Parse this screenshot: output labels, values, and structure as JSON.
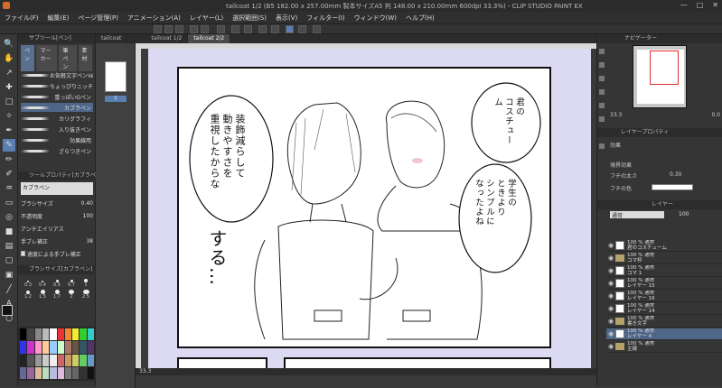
{
  "window": {
    "title": "tailcoat 1/2 (B5 182.00 x 257.00mm 製本サイズA5 判 148.00 x 210.00mm 600dpi 33.3%) - CLIP STUDIO PAINT EX",
    "controls": [
      "—",
      "□",
      "✕"
    ]
  },
  "menu": [
    "ファイル(F)",
    "編集(E)",
    "ページ管理(P)",
    "アニメーション(A)",
    "レイヤー(L)",
    "選択範囲(S)",
    "表示(V)",
    "フィルター(I)",
    "ウィンドウ(W)",
    "ヘルプ(H)"
  ],
  "subtool": {
    "header": "サブツール[ペン]",
    "tabs": [
      "ペン",
      "マーカー",
      "筆ペン",
      "素材"
    ],
    "brushes": [
      "お気軽文字ペンVer2.0",
      "ちょっぴりニッチな線文字ペン",
      "重っぽいGペン",
      "カブラペン",
      "カリグラフィ",
      "入り抜きペン",
      "効果線用",
      "ざらつきペン"
    ],
    "active_brush_index": 3
  },
  "tool_property": {
    "header": "ツールプロパティ[カブラペン]",
    "name": "カブラペン",
    "rows": [
      {
        "label": "ブラシサイズ",
        "value": "0.40"
      },
      {
        "label": "不透明度",
        "value": "100"
      },
      {
        "label": "アンチエイリアス",
        "value": ""
      },
      {
        "label": "手ブレ補正",
        "value": "38"
      },
      {
        "label": "速度による手ブレ補正",
        "value": ""
      }
    ]
  },
  "brush_size": {
    "header": "ブラシサイズ[カブラペン]",
    "sizes": [
      "0.3",
      "0.4",
      "0.5",
      "0.7",
      "1",
      "1.2",
      "1.5",
      "1.7",
      "2",
      "2.5"
    ]
  },
  "document_tabs": [
    "tailcoat",
    "tailcoat 1/2",
    "tailcoat 2/2"
  ],
  "page_strip": {
    "page_number": "1"
  },
  "status": {
    "zoom": "33.3"
  },
  "manga": {
    "bubble_left": "装飾減らして\n動きやすさを\n重視したからな",
    "bubble_right_top": "君の\nコスチューム",
    "bubble_right_bottom": "学生の\nときより\nシンプルに\nなったよね",
    "sfx": "する…"
  },
  "navigator": {
    "header": "ナビゲーター",
    "zoom": "33.3",
    "angle": "0.0"
  },
  "layer_property": {
    "header": "レイヤープロパティ",
    "effect_label": "効果",
    "border_label": "境界効果",
    "edge_width_label": "フチの太さ",
    "edge_width_value": "0.30",
    "edge_color_label": "フチの色"
  },
  "layers": {
    "header": "レイヤー",
    "blend": "通常",
    "opacity": "100",
    "rows": [
      {
        "line1": "100 % 通常",
        "line2": "君のコスチューム",
        "kind": "thumb"
      },
      {
        "line1": "100 % 通常",
        "line2": "コマ枠",
        "kind": "folder"
      },
      {
        "line1": "100 % 通常",
        "line2": "コマ 1",
        "kind": "thumb"
      },
      {
        "line1": "100 % 通常",
        "line2": "レイヤー 15",
        "kind": "thumb"
      },
      {
        "line1": "100 % 通常",
        "line2": "レイヤー 16",
        "kind": "thumb"
      },
      {
        "line1": "100 % 通常",
        "line2": "レイヤー 14",
        "kind": "thumb"
      },
      {
        "line1": "100 % 通常",
        "line2": "書き文字",
        "kind": "folder"
      },
      {
        "line1": "100 % 通常",
        "line2": "レイヤー 4",
        "kind": "thumb"
      },
      {
        "line1": "100 % 通常",
        "line2": "主線",
        "kind": "folder"
      }
    ],
    "active_index": 7
  },
  "colors": {
    "accent": "#5a7fb0",
    "paper": "#dcdaf3",
    "layer_active": "#4e6688"
  }
}
